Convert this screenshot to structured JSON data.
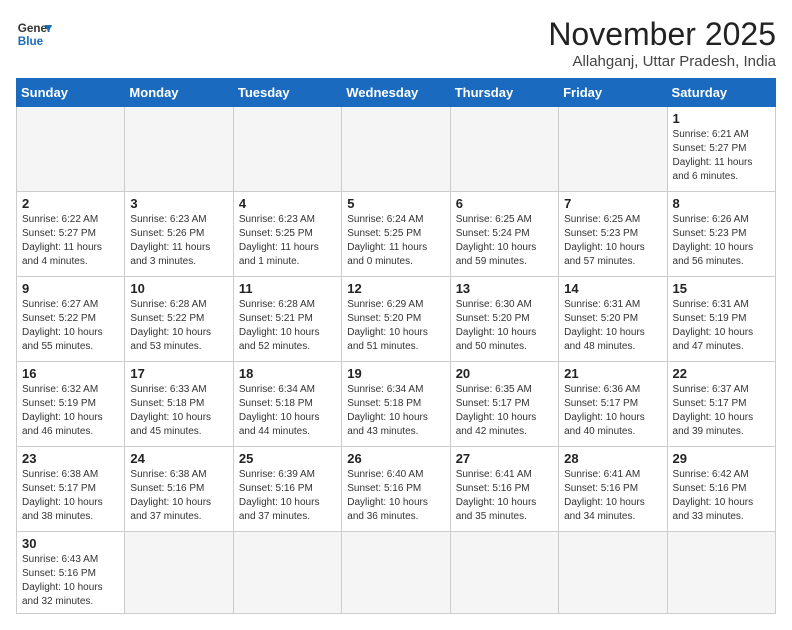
{
  "header": {
    "logo_general": "General",
    "logo_blue": "Blue",
    "month_title": "November 2025",
    "subtitle": "Allahganj, Uttar Pradesh, India"
  },
  "weekdays": [
    "Sunday",
    "Monday",
    "Tuesday",
    "Wednesday",
    "Thursday",
    "Friday",
    "Saturday"
  ],
  "weeks": [
    [
      {
        "day": "",
        "info": ""
      },
      {
        "day": "",
        "info": ""
      },
      {
        "day": "",
        "info": ""
      },
      {
        "day": "",
        "info": ""
      },
      {
        "day": "",
        "info": ""
      },
      {
        "day": "",
        "info": ""
      },
      {
        "day": "1",
        "info": "Sunrise: 6:21 AM\nSunset: 5:27 PM\nDaylight: 11 hours\nand 6 minutes."
      }
    ],
    [
      {
        "day": "2",
        "info": "Sunrise: 6:22 AM\nSunset: 5:27 PM\nDaylight: 11 hours\nand 4 minutes."
      },
      {
        "day": "3",
        "info": "Sunrise: 6:23 AM\nSunset: 5:26 PM\nDaylight: 11 hours\nand 3 minutes."
      },
      {
        "day": "4",
        "info": "Sunrise: 6:23 AM\nSunset: 5:25 PM\nDaylight: 11 hours\nand 1 minute."
      },
      {
        "day": "5",
        "info": "Sunrise: 6:24 AM\nSunset: 5:25 PM\nDaylight: 11 hours\nand 0 minutes."
      },
      {
        "day": "6",
        "info": "Sunrise: 6:25 AM\nSunset: 5:24 PM\nDaylight: 10 hours\nand 59 minutes."
      },
      {
        "day": "7",
        "info": "Sunrise: 6:25 AM\nSunset: 5:23 PM\nDaylight: 10 hours\nand 57 minutes."
      },
      {
        "day": "8",
        "info": "Sunrise: 6:26 AM\nSunset: 5:23 PM\nDaylight: 10 hours\nand 56 minutes."
      }
    ],
    [
      {
        "day": "9",
        "info": "Sunrise: 6:27 AM\nSunset: 5:22 PM\nDaylight: 10 hours\nand 55 minutes."
      },
      {
        "day": "10",
        "info": "Sunrise: 6:28 AM\nSunset: 5:22 PM\nDaylight: 10 hours\nand 53 minutes."
      },
      {
        "day": "11",
        "info": "Sunrise: 6:28 AM\nSunset: 5:21 PM\nDaylight: 10 hours\nand 52 minutes."
      },
      {
        "day": "12",
        "info": "Sunrise: 6:29 AM\nSunset: 5:20 PM\nDaylight: 10 hours\nand 51 minutes."
      },
      {
        "day": "13",
        "info": "Sunrise: 6:30 AM\nSunset: 5:20 PM\nDaylight: 10 hours\nand 50 minutes."
      },
      {
        "day": "14",
        "info": "Sunrise: 6:31 AM\nSunset: 5:20 PM\nDaylight: 10 hours\nand 48 minutes."
      },
      {
        "day": "15",
        "info": "Sunrise: 6:31 AM\nSunset: 5:19 PM\nDaylight: 10 hours\nand 47 minutes."
      }
    ],
    [
      {
        "day": "16",
        "info": "Sunrise: 6:32 AM\nSunset: 5:19 PM\nDaylight: 10 hours\nand 46 minutes."
      },
      {
        "day": "17",
        "info": "Sunrise: 6:33 AM\nSunset: 5:18 PM\nDaylight: 10 hours\nand 45 minutes."
      },
      {
        "day": "18",
        "info": "Sunrise: 6:34 AM\nSunset: 5:18 PM\nDaylight: 10 hours\nand 44 minutes."
      },
      {
        "day": "19",
        "info": "Sunrise: 6:34 AM\nSunset: 5:18 PM\nDaylight: 10 hours\nand 43 minutes."
      },
      {
        "day": "20",
        "info": "Sunrise: 6:35 AM\nSunset: 5:17 PM\nDaylight: 10 hours\nand 42 minutes."
      },
      {
        "day": "21",
        "info": "Sunrise: 6:36 AM\nSunset: 5:17 PM\nDaylight: 10 hours\nand 40 minutes."
      },
      {
        "day": "22",
        "info": "Sunrise: 6:37 AM\nSunset: 5:17 PM\nDaylight: 10 hours\nand 39 minutes."
      }
    ],
    [
      {
        "day": "23",
        "info": "Sunrise: 6:38 AM\nSunset: 5:17 PM\nDaylight: 10 hours\nand 38 minutes."
      },
      {
        "day": "24",
        "info": "Sunrise: 6:38 AM\nSunset: 5:16 PM\nDaylight: 10 hours\nand 37 minutes."
      },
      {
        "day": "25",
        "info": "Sunrise: 6:39 AM\nSunset: 5:16 PM\nDaylight: 10 hours\nand 37 minutes."
      },
      {
        "day": "26",
        "info": "Sunrise: 6:40 AM\nSunset: 5:16 PM\nDaylight: 10 hours\nand 36 minutes."
      },
      {
        "day": "27",
        "info": "Sunrise: 6:41 AM\nSunset: 5:16 PM\nDaylight: 10 hours\nand 35 minutes."
      },
      {
        "day": "28",
        "info": "Sunrise: 6:41 AM\nSunset: 5:16 PM\nDaylight: 10 hours\nand 34 minutes."
      },
      {
        "day": "29",
        "info": "Sunrise: 6:42 AM\nSunset: 5:16 PM\nDaylight: 10 hours\nand 33 minutes."
      }
    ],
    [
      {
        "day": "30",
        "info": "Sunrise: 6:43 AM\nSunset: 5:16 PM\nDaylight: 10 hours\nand 32 minutes."
      },
      {
        "day": "",
        "info": ""
      },
      {
        "day": "",
        "info": ""
      },
      {
        "day": "",
        "info": ""
      },
      {
        "day": "",
        "info": ""
      },
      {
        "day": "",
        "info": ""
      },
      {
        "day": "",
        "info": ""
      }
    ]
  ]
}
